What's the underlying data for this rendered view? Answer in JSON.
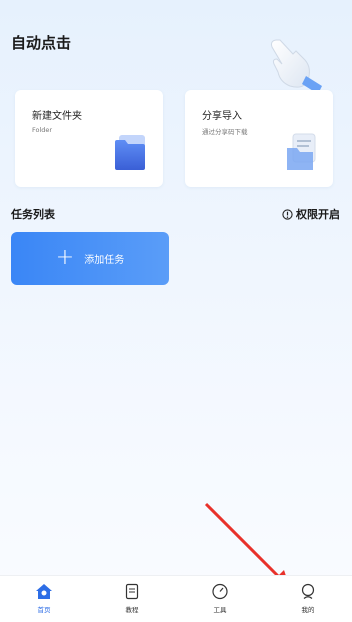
{
  "header": {
    "title": "自动点击"
  },
  "cards": [
    {
      "title": "新建文件夹",
      "subtitle": "Folder",
      "icon": "folder-icon"
    },
    {
      "title": "分享导入",
      "subtitle": "通过分享码下载",
      "icon": "share-import-icon"
    }
  ],
  "tasks": {
    "title": "任务列表",
    "permission_label": "权限开启",
    "add_label": "添加任务"
  },
  "tabbar": {
    "items": [
      {
        "label": "首页",
        "icon": "home-icon",
        "active": true
      },
      {
        "label": "教程",
        "icon": "tutorial-icon",
        "active": false
      },
      {
        "label": "工具",
        "icon": "tools-icon",
        "active": false
      },
      {
        "label": "我的",
        "icon": "profile-icon",
        "active": false
      }
    ]
  },
  "colors": {
    "accent": "#3a86f6",
    "annotation_arrow": "#e8312a"
  }
}
